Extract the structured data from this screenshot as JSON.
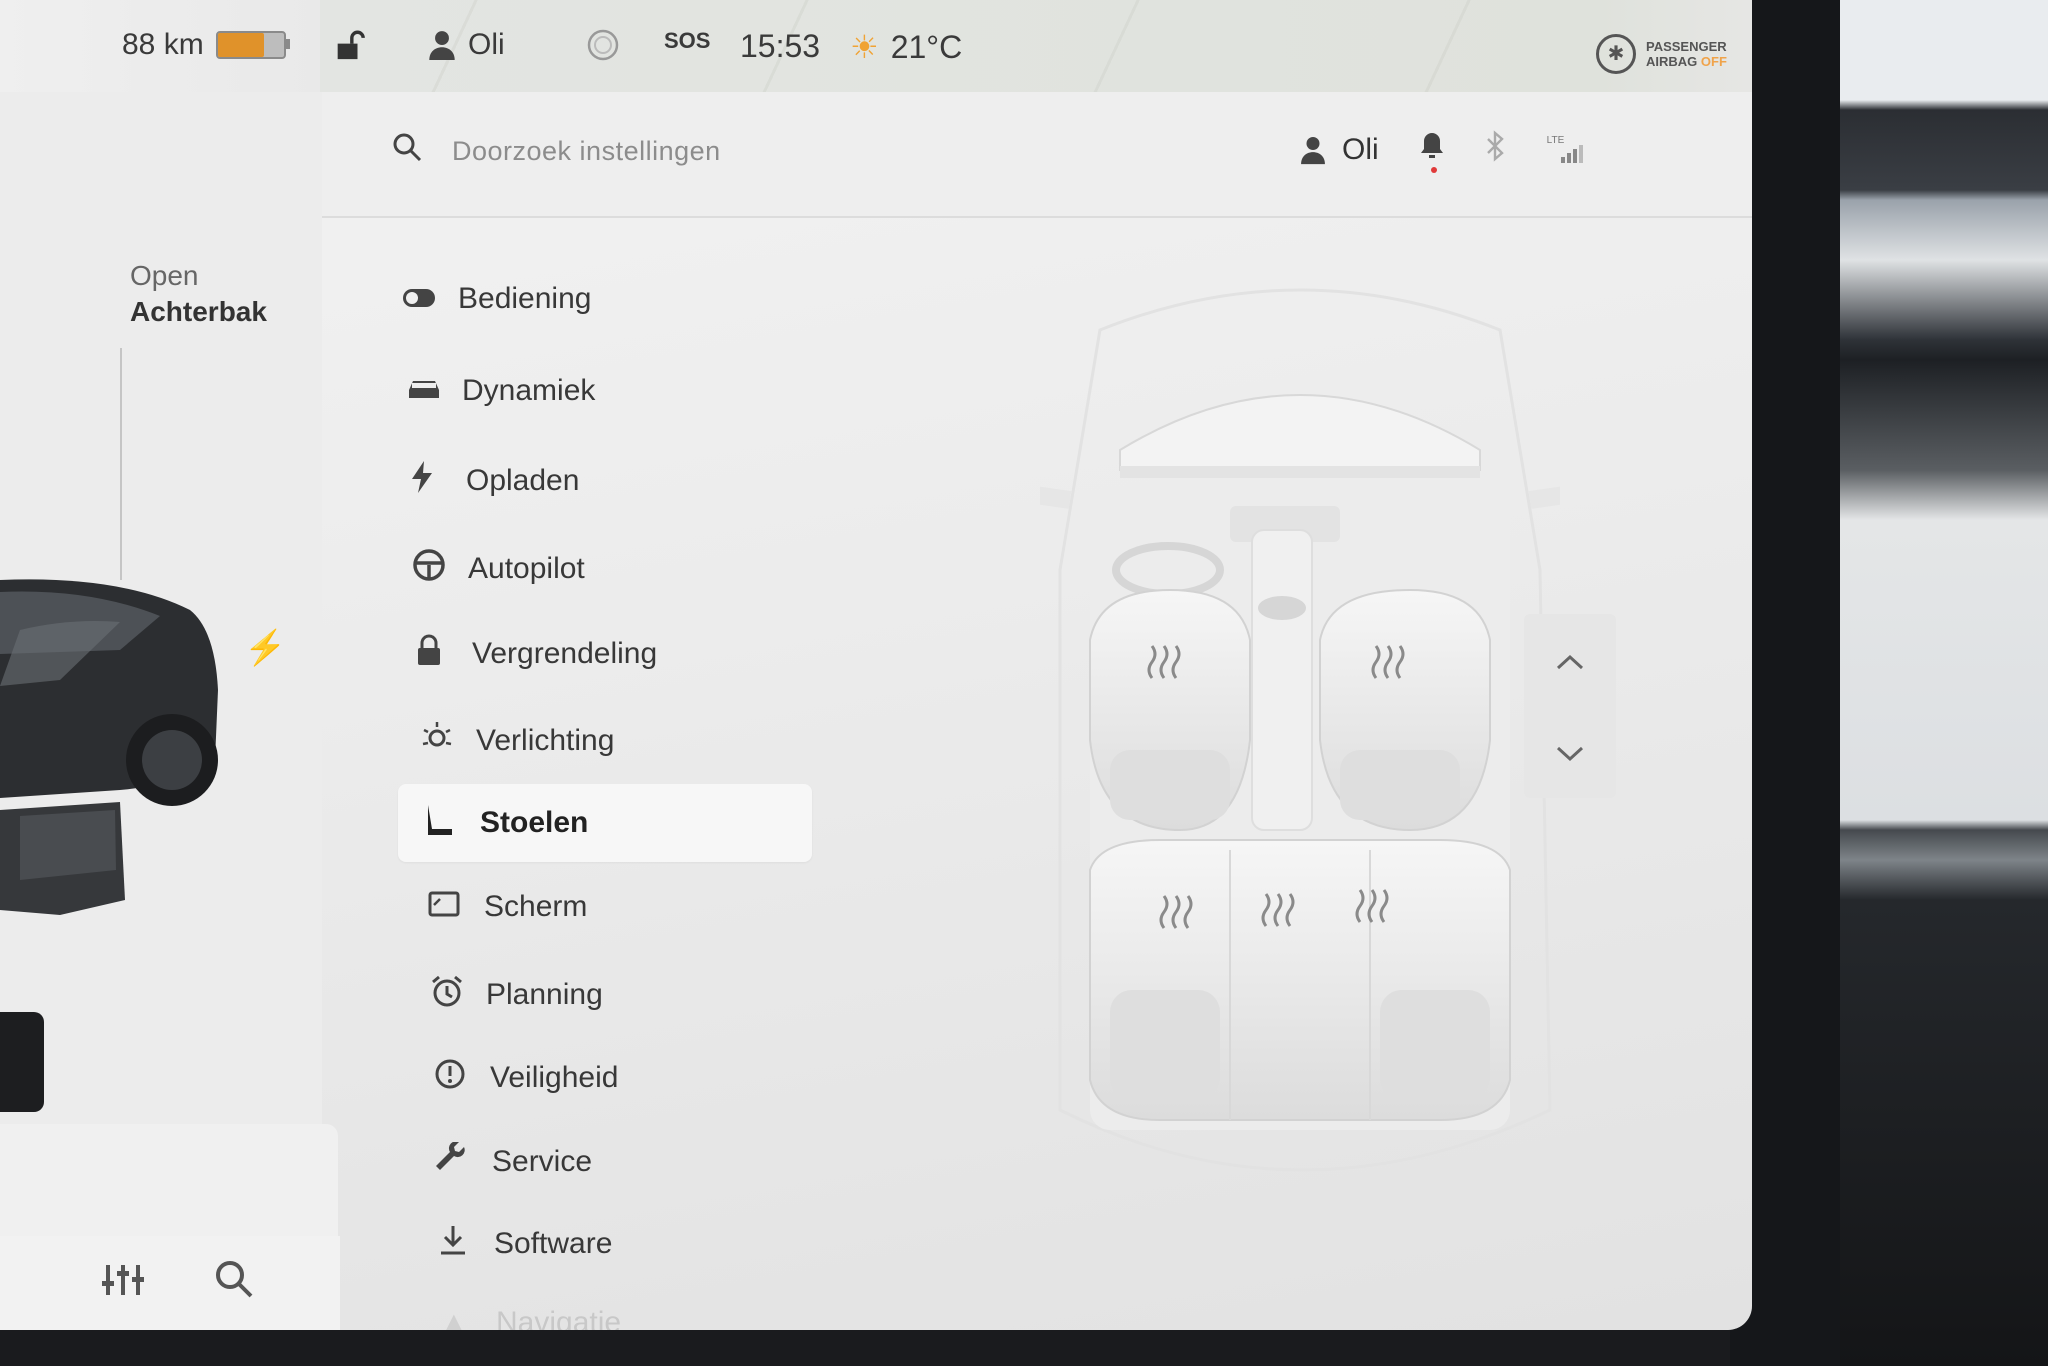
{
  "status_bar": {
    "range": "88 km",
    "battery_level": 0.7,
    "driver": "Oli",
    "sos": "SOS",
    "time": "15:53",
    "temperature": "21°C",
    "airbag_line1": "PASSENGER",
    "airbag_line2": "AIRBAG",
    "airbag_state": "OFF"
  },
  "left_panel": {
    "trunk_action": "Open",
    "trunk_label": "Achterbak"
  },
  "header": {
    "search_placeholder": "Doorzoek instellingen",
    "profile_name": "Oli",
    "lte_label": "LTE"
  },
  "menu": {
    "items": [
      {
        "label": "Bediening",
        "icon": "toggle-icon"
      },
      {
        "label": "Dynamiek",
        "icon": "car-icon"
      },
      {
        "label": "Opladen",
        "icon": "bolt-icon"
      },
      {
        "label": "Autopilot",
        "icon": "steering-wheel-icon"
      },
      {
        "label": "Vergrendeling",
        "icon": "lock-icon"
      },
      {
        "label": "Verlichting",
        "icon": "light-icon"
      },
      {
        "label": "Stoelen",
        "icon": "seat-icon",
        "selected": true
      },
      {
        "label": "Scherm",
        "icon": "display-icon"
      },
      {
        "label": "Planning",
        "icon": "alarm-clock-icon"
      },
      {
        "label": "Veiligheid",
        "icon": "safety-icon"
      },
      {
        "label": "Service",
        "icon": "wrench-icon"
      },
      {
        "label": "Software",
        "icon": "download-icon"
      },
      {
        "label": "Navigatie",
        "icon": "navigation-icon"
      }
    ]
  },
  "colors": {
    "battery": "#e0922a",
    "notification_dot": "#e03a3a",
    "airbag_off": "#f0a34a"
  }
}
